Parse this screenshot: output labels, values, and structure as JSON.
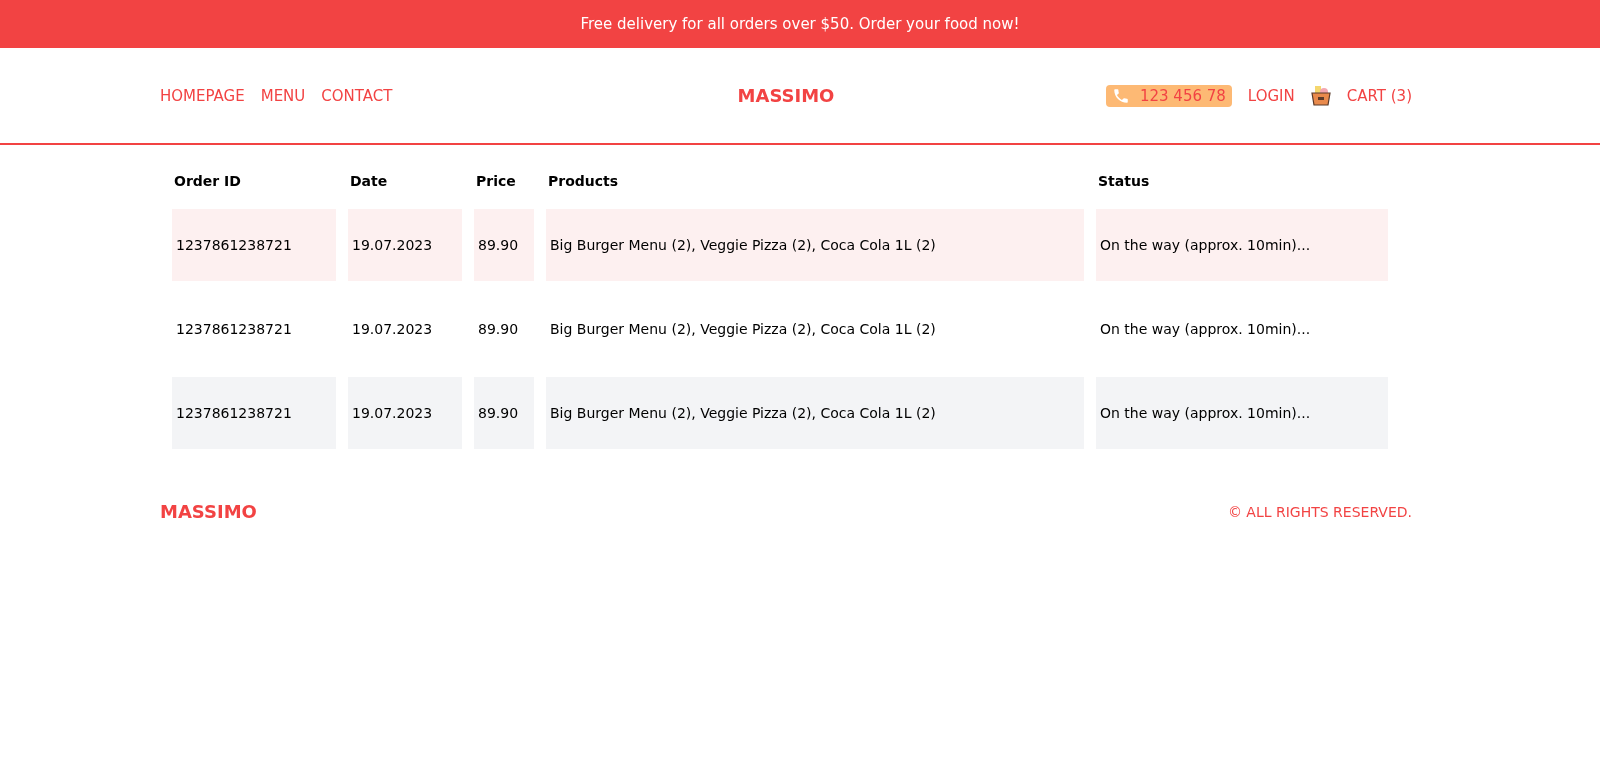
{
  "banner": {
    "text": "Free delivery for all orders over $50. Order your food now!"
  },
  "nav": {
    "links": [
      "HOMEPAGE",
      "MENU",
      "CONTACT"
    ],
    "logo": "MASSIMO",
    "phone": "123 456 78",
    "login": "LOGIN",
    "cart": "CART (3)"
  },
  "table": {
    "columns": [
      "Order ID",
      "Date",
      "Price",
      "Products",
      "Status"
    ],
    "rows": [
      {
        "kind": "highlight",
        "cells": [
          "1237861238721",
          "19.07.2023",
          "89.90",
          "Big Burger Menu (2), Veggie Pizza (2), Coca Cola 1L (2)",
          "On the way (approx. 10min)..."
        ]
      },
      {
        "kind": "plain",
        "cells": [
          "1237861238721",
          "19.07.2023",
          "89.90",
          "Big Burger Menu (2), Veggie Pizza (2), Coca Cola 1L (2)",
          "On the way (approx. 10min)..."
        ]
      },
      {
        "kind": "muted",
        "cells": [
          "1237861238721",
          "19.07.2023",
          "89.90",
          "Big Burger Menu (2), Veggie Pizza (2), Coca Cola 1L (2)",
          "On the way (approx. 10min)..."
        ]
      }
    ]
  },
  "footer": {
    "logo": "MASSIMO",
    "rights": "© ALL RIGHTS RESERVED."
  }
}
